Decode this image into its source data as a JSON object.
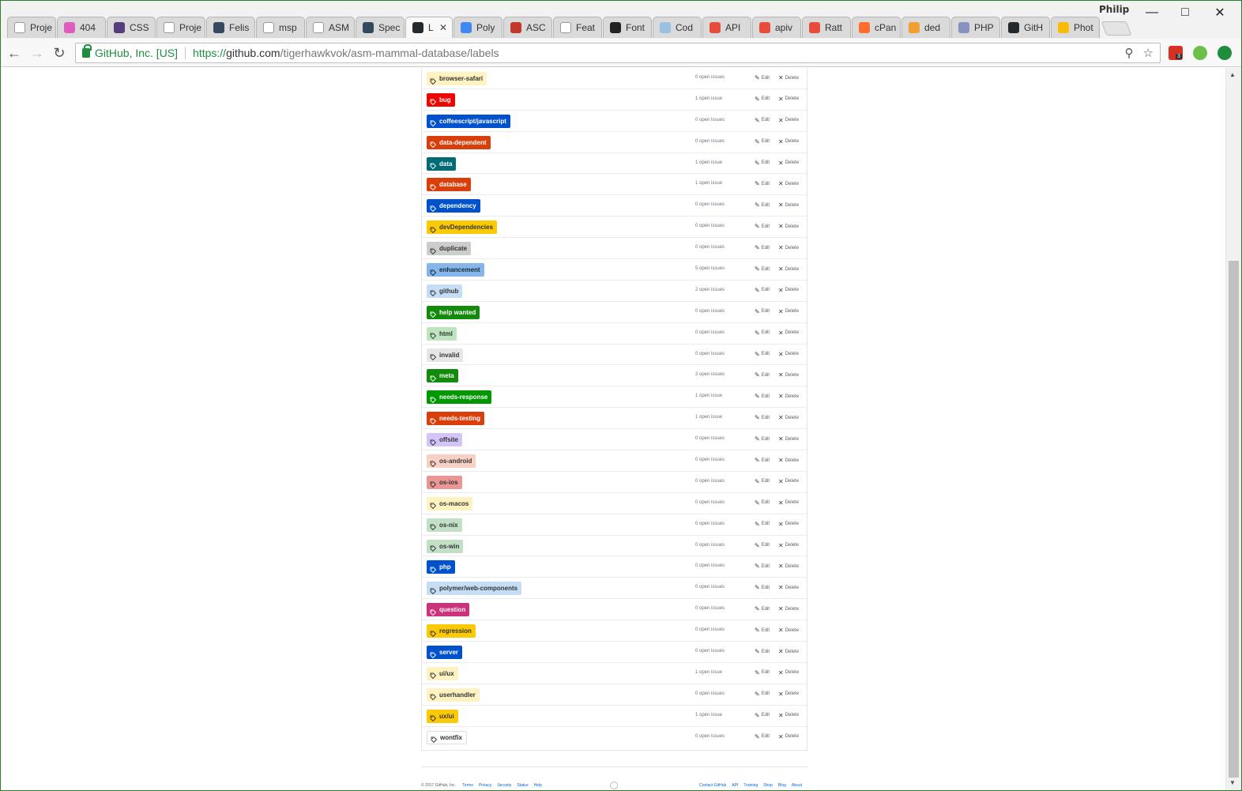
{
  "browser": {
    "profile_name": "Philip",
    "tabs": [
      {
        "label": "Proje",
        "icon": "scissors-icon",
        "color": "#ffffff",
        "active": false
      },
      {
        "label": "404",
        "icon": "pink-circle-icon",
        "color": "#e05dc0",
        "active": false
      },
      {
        "label": "CSS",
        "icon": "bootstrap-b-icon",
        "color": "#563d7c",
        "active": false
      },
      {
        "label": "Proje",
        "icon": "scissors-icon",
        "color": "#ffffff",
        "active": false
      },
      {
        "label": "Felis",
        "icon": "o-square-icon",
        "color": "#34495e",
        "active": false
      },
      {
        "label": "msp",
        "icon": "page-icon",
        "color": "#ffffff",
        "active": false
      },
      {
        "label": "ASM",
        "icon": "scissors-icon",
        "color": "#ffffff",
        "active": false
      },
      {
        "label": "Spec",
        "icon": "o-square-icon",
        "color": "#34495e",
        "active": false
      },
      {
        "label": "L",
        "icon": "github-icon",
        "color": "#24292e",
        "active": true
      },
      {
        "label": "Poly",
        "icon": "polymer-icon",
        "color": "#3f88f6",
        "active": false
      },
      {
        "label": "ASC",
        "icon": "shield-icon",
        "color": "#c0392b",
        "active": false
      },
      {
        "label": "Feat",
        "icon": "feather-icon",
        "color": "#ffffff",
        "active": false
      },
      {
        "label": "Font",
        "icon": "flag-icon",
        "color": "#222222",
        "active": false
      },
      {
        "label": "Cod",
        "icon": "codepen-icon",
        "color": "#9ac1e0",
        "active": false
      },
      {
        "label": "API",
        "icon": "red-drop-icon",
        "color": "#e74c3c",
        "active": false
      },
      {
        "label": "apiv",
        "icon": "red-drop-icon",
        "color": "#e74c3c",
        "active": false
      },
      {
        "label": "Ratt",
        "icon": "red-drop-icon",
        "color": "#e74c3c",
        "active": false
      },
      {
        "label": "cPan",
        "icon": "cpanel-icon",
        "color": "#ff6c2c",
        "active": false
      },
      {
        "label": "ded",
        "icon": "pma-icon",
        "color": "#f0a030",
        "active": false
      },
      {
        "label": "PHP",
        "icon": "php-icon",
        "color": "#8892bf",
        "active": false
      },
      {
        "label": "GitH",
        "icon": "github-icon",
        "color": "#24292e",
        "active": false
      },
      {
        "label": "Phot",
        "icon": "pinwheel-icon",
        "color": "#fbbc05",
        "active": false
      }
    ],
    "address": {
      "secure_label": "GitHub, Inc. [US]",
      "url_proto": "https://",
      "url_host": "github.com",
      "url_path": "/tigerhawkvok/asm-mammal-database/labels"
    },
    "extensions": {
      "badge_count": "3"
    }
  },
  "page": {
    "edit_label": "Edit",
    "delete_label": "Delete",
    "labels": [
      {
        "name": "browser-safari",
        "issues": "0 open issues",
        "bg": "#fef2c0",
        "fg": "#333333"
      },
      {
        "name": "bug",
        "issues": "1 open issue",
        "bg": "#ee0701",
        "fg": "#ffffff"
      },
      {
        "name": "coffeescript/javascript",
        "issues": "0 open issues",
        "bg": "#0052cc",
        "fg": "#ffffff"
      },
      {
        "name": "data-dependent",
        "issues": "0 open issues",
        "bg": "#d93f0b",
        "fg": "#ffffff"
      },
      {
        "name": "data",
        "issues": "1 open issue",
        "bg": "#006b75",
        "fg": "#ffffff"
      },
      {
        "name": "database",
        "issues": "1 open issue",
        "bg": "#d93f0b",
        "fg": "#ffffff"
      },
      {
        "name": "dependency",
        "issues": "0 open issues",
        "bg": "#0052cc",
        "fg": "#ffffff"
      },
      {
        "name": "devDependencies",
        "issues": "0 open issues",
        "bg": "#fbca04",
        "fg": "#333333"
      },
      {
        "name": "duplicate",
        "issues": "0 open issues",
        "bg": "#cccccc",
        "fg": "#333333"
      },
      {
        "name": "enhancement",
        "issues": "5 open issues",
        "bg": "#84b6eb",
        "fg": "#1c2733"
      },
      {
        "name": "github",
        "issues": "2 open issues",
        "bg": "#c5def5",
        "fg": "#333333"
      },
      {
        "name": "help wanted",
        "issues": "0 open issues",
        "bg": "#128a0c",
        "fg": "#ffffff"
      },
      {
        "name": "html",
        "issues": "0 open issues",
        "bg": "#bfe5bf",
        "fg": "#333333"
      },
      {
        "name": "invalid",
        "issues": "0 open issues",
        "bg": "#e6e6e6",
        "fg": "#333333"
      },
      {
        "name": "meta",
        "issues": "2 open issues",
        "bg": "#128a0c",
        "fg": "#ffffff"
      },
      {
        "name": "needs-response",
        "issues": "1 open issue",
        "bg": "#009800",
        "fg": "#ffffff"
      },
      {
        "name": "needs-testing",
        "issues": "1 open issue",
        "bg": "#d93f0b",
        "fg": "#ffffff"
      },
      {
        "name": "offsite",
        "issues": "0 open issues",
        "bg": "#d4c5f9",
        "fg": "#333333"
      },
      {
        "name": "os-android",
        "issues": "0 open issues",
        "bg": "#f9d0c4",
        "fg": "#333333"
      },
      {
        "name": "os-ios",
        "issues": "0 open issues",
        "bg": "#e99695",
        "fg": "#333333"
      },
      {
        "name": "os-macos",
        "issues": "0 open issues",
        "bg": "#fef2c0",
        "fg": "#333333"
      },
      {
        "name": "os-nix",
        "issues": "0 open issues",
        "bg": "#c2e0c6",
        "fg": "#333333"
      },
      {
        "name": "os-win",
        "issues": "0 open issues",
        "bg": "#c2e0c6",
        "fg": "#333333"
      },
      {
        "name": "php",
        "issues": "0 open issues",
        "bg": "#0052cc",
        "fg": "#ffffff"
      },
      {
        "name": "polymer/web-components",
        "issues": "0 open issues",
        "bg": "#c5def5",
        "fg": "#333333"
      },
      {
        "name": "question",
        "issues": "0 open issues",
        "bg": "#cc317c",
        "fg": "#ffffff"
      },
      {
        "name": "regression",
        "issues": "0 open issues",
        "bg": "#fbca04",
        "fg": "#333333"
      },
      {
        "name": "server",
        "issues": "0 open issues",
        "bg": "#0052cc",
        "fg": "#ffffff"
      },
      {
        "name": "ui/ux",
        "issues": "1 open issue",
        "bg": "#fef2c0",
        "fg": "#333333"
      },
      {
        "name": "userhandler",
        "issues": "0 open issues",
        "bg": "#fef2c0",
        "fg": "#333333"
      },
      {
        "name": "ux/ui",
        "issues": "1 open issue",
        "bg": "#fbca04",
        "fg": "#333333"
      },
      {
        "name": "wontfix",
        "issues": "0 open issues",
        "bg": "#ffffff",
        "fg": "#333333"
      }
    ],
    "footer": {
      "copyright": "© 2017 GitHub, Inc.",
      "left_links": [
        "Terms",
        "Privacy",
        "Security",
        "Status",
        "Help"
      ],
      "right_links": [
        "Contact GitHub",
        "API",
        "Training",
        "Shop",
        "Blog",
        "About"
      ]
    }
  }
}
